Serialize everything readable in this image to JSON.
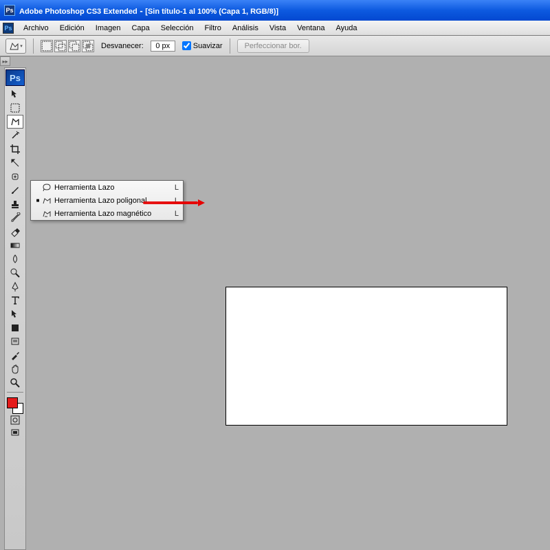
{
  "titlebar": {
    "app": "Adobe Photoshop CS3 Extended",
    "doc": "[Sin título-1 al 100% (Capa 1, RGB/8)]"
  },
  "menu": {
    "items": [
      "Archivo",
      "Edición",
      "Imagen",
      "Capa",
      "Selección",
      "Filtro",
      "Análisis",
      "Vista",
      "Ventana",
      "Ayuda"
    ]
  },
  "options": {
    "feather_label": "Desvanecer:",
    "feather_value": "0 px",
    "antialias_label": "Suavizar",
    "antialias_checked": true,
    "refine_label": "Perfeccionar bor."
  },
  "flyout": {
    "items": [
      {
        "label": "Herramienta Lazo",
        "key": "L",
        "selected": false,
        "icon": "lasso"
      },
      {
        "label": "Herramienta Lazo poligonal",
        "key": "L",
        "selected": true,
        "icon": "poly"
      },
      {
        "label": "Herramienta Lazo magnético",
        "key": "L",
        "selected": false,
        "icon": "magnetic"
      }
    ]
  },
  "colors": {
    "foreground": "#e41b1b",
    "background": "#ffffff"
  },
  "tools": [
    "move",
    "marquee",
    "lasso",
    "wand",
    "crop",
    "slice",
    "heal",
    "brush",
    "stamp",
    "history-brush",
    "eraser",
    "gradient",
    "blur",
    "dodge",
    "pen",
    "type",
    "path-select",
    "shape",
    "notes",
    "eyedropper",
    "hand",
    "zoom"
  ]
}
